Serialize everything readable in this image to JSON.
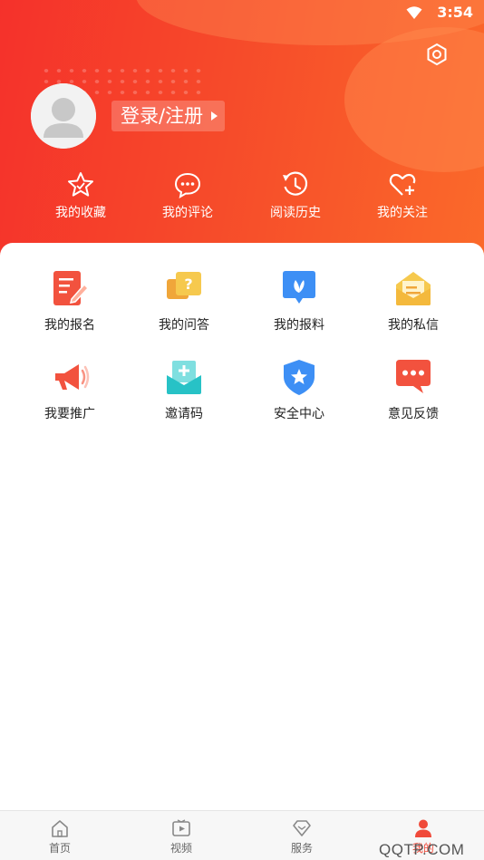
{
  "status_bar": {
    "time": "3:54"
  },
  "profile": {
    "login_label": "登录/注册"
  },
  "quick_actions": [
    {
      "label": "我的收藏",
      "icon": "star-icon"
    },
    {
      "label": "我的评论",
      "icon": "comment-icon"
    },
    {
      "label": "阅读历史",
      "icon": "history-icon"
    },
    {
      "label": "我的关注",
      "icon": "heart-plus-icon"
    }
  ],
  "grid": [
    {
      "label": "我的报名",
      "icon": "signup-icon",
      "color": "#f2523e"
    },
    {
      "label": "我的问答",
      "icon": "qa-icon",
      "color": "#f4c14a"
    },
    {
      "label": "我的报料",
      "icon": "report-icon",
      "color": "#3d8ff5"
    },
    {
      "label": "我的私信",
      "icon": "message-icon",
      "color": "#f4c14a"
    },
    {
      "label": "我要推广",
      "icon": "megaphone-icon",
      "color": "#f2523e"
    },
    {
      "label": "邀请码",
      "icon": "invite-icon",
      "color": "#27c2c6"
    },
    {
      "label": "安全中心",
      "icon": "shield-icon",
      "color": "#3d8ff5"
    },
    {
      "label": "意见反馈",
      "icon": "feedback-icon",
      "color": "#f2523e"
    }
  ],
  "tabbar": [
    {
      "label": "首页",
      "icon": "home-icon"
    },
    {
      "label": "视频",
      "icon": "video-icon"
    },
    {
      "label": "服务",
      "icon": "service-icon"
    },
    {
      "label": "我的",
      "icon": "user-icon",
      "active": true
    }
  ],
  "watermark": "QQTP.COM",
  "colors": {
    "header_start": "#f5312b",
    "header_end": "#fb6a2a",
    "active_tab": "#f04a3a"
  }
}
